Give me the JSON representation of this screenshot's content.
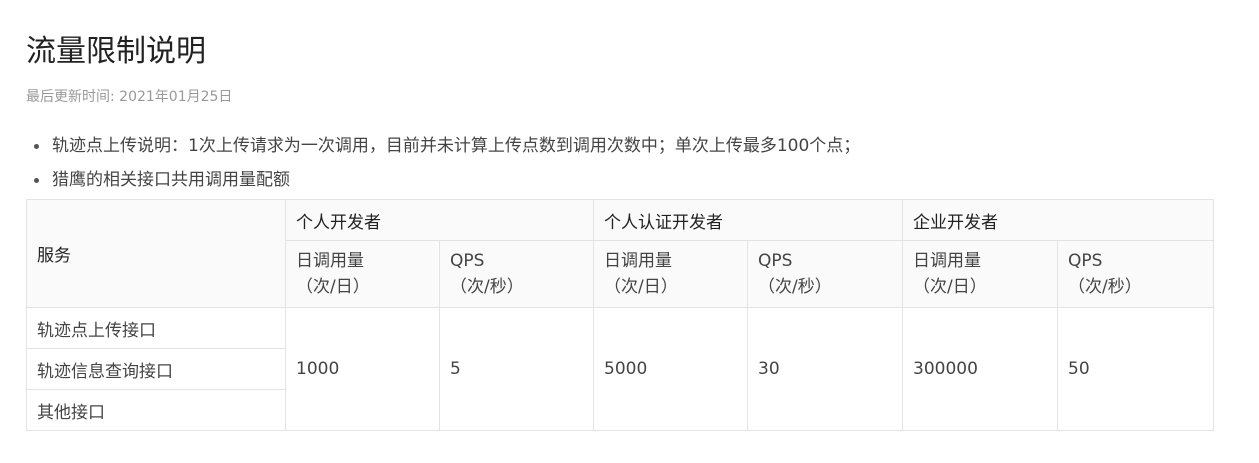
{
  "page": {
    "title": "流量限制说明",
    "updated": "最后更新时间: 2021年01月25日"
  },
  "notes": [
    "轨迹点上传说明：1次上传请求为一次调用，目前并未计算上传点数到调用次数中；单次上传最多100个点；",
    "猎鹰的相关接口共用调用量配额"
  ],
  "table": {
    "service_header": "服务",
    "groups": [
      "个人开发者",
      "个人认证开发者",
      "企业开发者"
    ],
    "sub_headers": {
      "daily_line1": "日调用量",
      "daily_line2": "（次/日）",
      "qps_line1": "QPS",
      "qps_line2": "（次/秒）"
    },
    "services": [
      "轨迹点上传接口",
      "轨迹信息查询接口",
      "其他接口"
    ],
    "values": {
      "personal_daily": "1000",
      "personal_qps": "5",
      "verified_daily": "5000",
      "verified_qps": "30",
      "enterprise_daily": "300000",
      "enterprise_qps": "50"
    }
  }
}
